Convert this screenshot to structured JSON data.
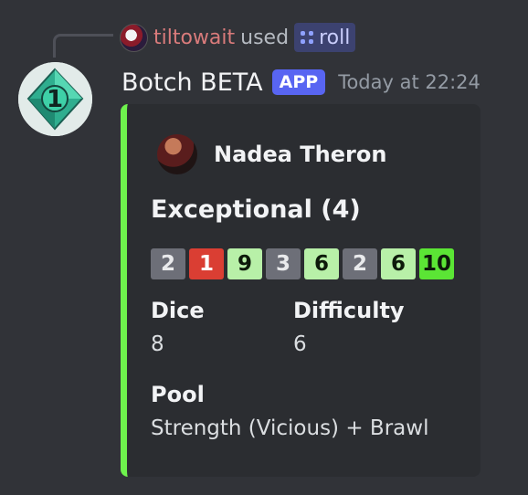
{
  "command_line": {
    "user": "tiltowait",
    "used_text": "used",
    "command": "roll"
  },
  "message": {
    "bot_name": "Botch BETA",
    "badge": "APP",
    "timestamp": "Today at 22:24",
    "avatar_icon": "d10-die-icon",
    "avatar_number": "1"
  },
  "embed": {
    "accent_color": "#6ef24d",
    "author": "Nadea Theron",
    "title": "Exceptional (4)",
    "dice": [
      {
        "value": "2",
        "kind": "fail"
      },
      {
        "value": "1",
        "kind": "botch"
      },
      {
        "value": "9",
        "kind": "success"
      },
      {
        "value": "3",
        "kind": "fail"
      },
      {
        "value": "6",
        "kind": "success"
      },
      {
        "value": "2",
        "kind": "fail"
      },
      {
        "value": "6",
        "kind": "success"
      },
      {
        "value": "10",
        "kind": "critical"
      }
    ],
    "fields": {
      "dice": {
        "name": "Dice",
        "value": "8"
      },
      "difficulty": {
        "name": "Difficulty",
        "value": "6"
      },
      "pool": {
        "name": "Pool",
        "value": "Strength (Vicious) + Brawl"
      }
    }
  },
  "colors": {
    "fail": "#6d6f78",
    "botch": "#da3e33",
    "success": "#b8f0a8",
    "critical": "#5be535"
  }
}
